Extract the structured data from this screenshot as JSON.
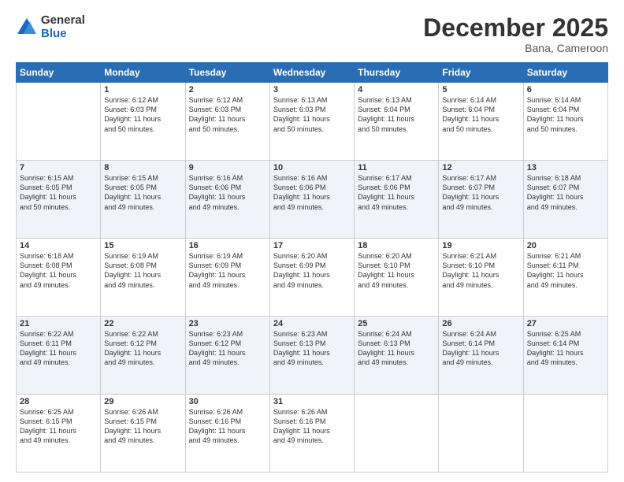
{
  "logo": {
    "general": "General",
    "blue": "Blue"
  },
  "header": {
    "month": "December 2025",
    "location": "Bana, Cameroon"
  },
  "days": [
    "Sunday",
    "Monday",
    "Tuesday",
    "Wednesday",
    "Thursday",
    "Friday",
    "Saturday"
  ],
  "weeks": [
    [
      {
        "day": "",
        "info": ""
      },
      {
        "day": "1",
        "info": "Sunrise: 6:12 AM\nSunset: 6:03 PM\nDaylight: 11 hours\nand 50 minutes."
      },
      {
        "day": "2",
        "info": "Sunrise: 6:12 AM\nSunset: 6:03 PM\nDaylight: 11 hours\nand 50 minutes."
      },
      {
        "day": "3",
        "info": "Sunrise: 6:13 AM\nSunset: 6:03 PM\nDaylight: 11 hours\nand 50 minutes."
      },
      {
        "day": "4",
        "info": "Sunrise: 6:13 AM\nSunset: 6:04 PM\nDaylight: 11 hours\nand 50 minutes."
      },
      {
        "day": "5",
        "info": "Sunrise: 6:14 AM\nSunset: 6:04 PM\nDaylight: 11 hours\nand 50 minutes."
      },
      {
        "day": "6",
        "info": "Sunrise: 6:14 AM\nSunset: 6:04 PM\nDaylight: 11 hours\nand 50 minutes."
      }
    ],
    [
      {
        "day": "7",
        "info": "Sunrise: 6:15 AM\nSunset: 6:05 PM\nDaylight: 11 hours\nand 50 minutes."
      },
      {
        "day": "8",
        "info": "Sunrise: 6:15 AM\nSunset: 6:05 PM\nDaylight: 11 hours\nand 49 minutes."
      },
      {
        "day": "9",
        "info": "Sunrise: 6:16 AM\nSunset: 6:06 PM\nDaylight: 11 hours\nand 49 minutes."
      },
      {
        "day": "10",
        "info": "Sunrise: 6:16 AM\nSunset: 6:06 PM\nDaylight: 11 hours\nand 49 minutes."
      },
      {
        "day": "11",
        "info": "Sunrise: 6:17 AM\nSunset: 6:06 PM\nDaylight: 11 hours\nand 49 minutes."
      },
      {
        "day": "12",
        "info": "Sunrise: 6:17 AM\nSunset: 6:07 PM\nDaylight: 11 hours\nand 49 minutes."
      },
      {
        "day": "13",
        "info": "Sunrise: 6:18 AM\nSunset: 6:07 PM\nDaylight: 11 hours\nand 49 minutes."
      }
    ],
    [
      {
        "day": "14",
        "info": "Sunrise: 6:18 AM\nSunset: 6:08 PM\nDaylight: 11 hours\nand 49 minutes."
      },
      {
        "day": "15",
        "info": "Sunrise: 6:19 AM\nSunset: 6:08 PM\nDaylight: 11 hours\nand 49 minutes."
      },
      {
        "day": "16",
        "info": "Sunrise: 6:19 AM\nSunset: 6:09 PM\nDaylight: 11 hours\nand 49 minutes."
      },
      {
        "day": "17",
        "info": "Sunrise: 6:20 AM\nSunset: 6:09 PM\nDaylight: 11 hours\nand 49 minutes."
      },
      {
        "day": "18",
        "info": "Sunrise: 6:20 AM\nSunset: 6:10 PM\nDaylight: 11 hours\nand 49 minutes."
      },
      {
        "day": "19",
        "info": "Sunrise: 6:21 AM\nSunset: 6:10 PM\nDaylight: 11 hours\nand 49 minutes."
      },
      {
        "day": "20",
        "info": "Sunrise: 6:21 AM\nSunset: 6:11 PM\nDaylight: 11 hours\nand 49 minutes."
      }
    ],
    [
      {
        "day": "21",
        "info": "Sunrise: 6:22 AM\nSunset: 6:11 PM\nDaylight: 11 hours\nand 49 minutes."
      },
      {
        "day": "22",
        "info": "Sunrise: 6:22 AM\nSunset: 6:12 PM\nDaylight: 11 hours\nand 49 minutes."
      },
      {
        "day": "23",
        "info": "Sunrise: 6:23 AM\nSunset: 6:12 PM\nDaylight: 11 hours\nand 49 minutes."
      },
      {
        "day": "24",
        "info": "Sunrise: 6:23 AM\nSunset: 6:13 PM\nDaylight: 11 hours\nand 49 minutes."
      },
      {
        "day": "25",
        "info": "Sunrise: 6:24 AM\nSunset: 6:13 PM\nDaylight: 11 hours\nand 49 minutes."
      },
      {
        "day": "26",
        "info": "Sunrise: 6:24 AM\nSunset: 6:14 PM\nDaylight: 11 hours\nand 49 minutes."
      },
      {
        "day": "27",
        "info": "Sunrise: 6:25 AM\nSunset: 6:14 PM\nDaylight: 11 hours\nand 49 minutes."
      }
    ],
    [
      {
        "day": "28",
        "info": "Sunrise: 6:25 AM\nSunset: 6:15 PM\nDaylight: 11 hours\nand 49 minutes."
      },
      {
        "day": "29",
        "info": "Sunrise: 6:26 AM\nSunset: 6:15 PM\nDaylight: 11 hours\nand 49 minutes."
      },
      {
        "day": "30",
        "info": "Sunrise: 6:26 AM\nSunset: 6:16 PM\nDaylight: 11 hours\nand 49 minutes."
      },
      {
        "day": "31",
        "info": "Sunrise: 6:26 AM\nSunset: 6:16 PM\nDaylight: 11 hours\nand 49 minutes."
      },
      {
        "day": "",
        "info": ""
      },
      {
        "day": "",
        "info": ""
      },
      {
        "day": "",
        "info": ""
      }
    ]
  ]
}
